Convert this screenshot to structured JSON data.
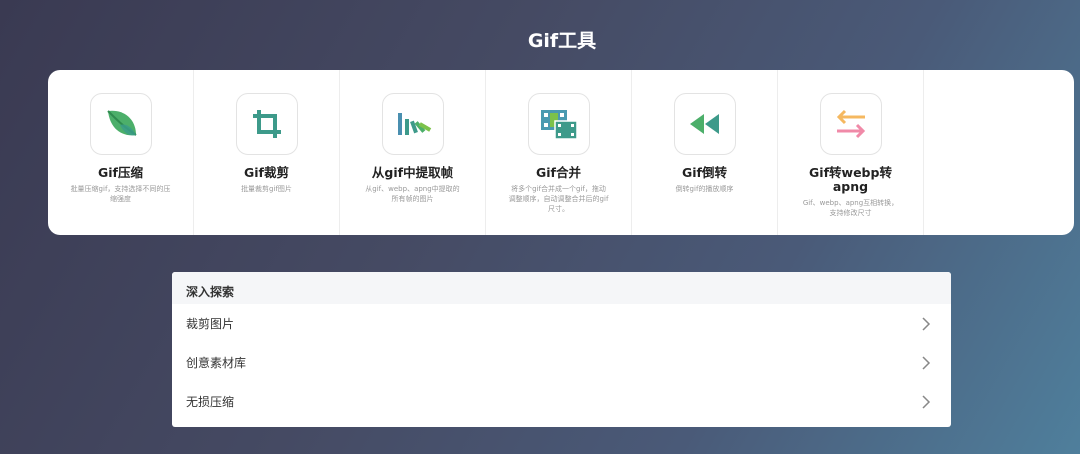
{
  "header": {
    "title": "Gif工具"
  },
  "tools": [
    {
      "name": "Gif压缩",
      "desc": "批量压缩gif，支持选择不同的压缩强度",
      "icon": "leaf-icon"
    },
    {
      "name": "Gif裁剪",
      "desc": "批量裁剪gif图片",
      "icon": "crop-icon"
    },
    {
      "name": "从gif中提取帧",
      "desc": "从gif、webp、apng中提取的所有帧的图片",
      "icon": "frames-extract-icon"
    },
    {
      "name": "Gif合并",
      "desc": "将多个gif合并成一个gif，拖动调整顺序，自动调整合并后的gif尺寸。",
      "icon": "film-merge-icon"
    },
    {
      "name": "Gif倒转",
      "desc": "倒转gif的播放顺序",
      "icon": "rewind-icon"
    },
    {
      "name": "Gif转webp转apng",
      "desc": "Gif、webp、apng互相转换，支持修改尺寸",
      "icon": "convert-arrows-icon"
    }
  ],
  "explore": {
    "title": "深入探索",
    "items": [
      {
        "label": "裁剪图片"
      },
      {
        "label": "创意素材库"
      },
      {
        "label": "无损压缩"
      }
    ]
  },
  "colors": {
    "leaf": "#4caf6a",
    "crop": "#3d9a8a",
    "film": "#4a9ab0",
    "rewind": "#4caf6a",
    "arrow_top": "#f5b860",
    "arrow_bottom": "#f08aa8"
  }
}
